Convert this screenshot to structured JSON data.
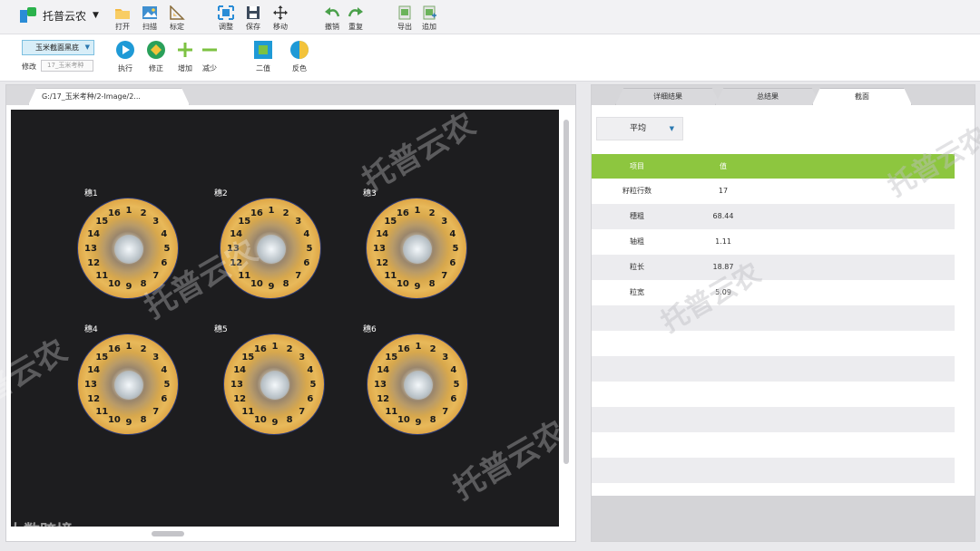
{
  "app": {
    "name": "托普云农"
  },
  "toolbar": {
    "open": "打开",
    "scan": "扫描",
    "calibrate": "标定",
    "adjust": "调整",
    "save": "保存",
    "move": "移动",
    "undo": "撤销",
    "redo": "重复",
    "export": "导出",
    "append": "追加"
  },
  "ribbon": {
    "mode_value": "玉米截面黑底",
    "edit_label": "修改",
    "edit_value": "17_玉米考种",
    "execute": "执行",
    "correct": "修正",
    "add": "增加",
    "reduce": "减少",
    "binary": "二值",
    "invert": "反色"
  },
  "image_panel": {
    "tab_label": "G:/17_玉米考种/2-Image/2...",
    "ears": [
      {
        "label": "穗1"
      },
      {
        "label": "穗2"
      },
      {
        "label": "穗3"
      },
      {
        "label": "穗4"
      },
      {
        "label": "穗5"
      },
      {
        "label": "穗6"
      }
    ],
    "kernel_numbers": [
      "1",
      "2",
      "3",
      "4",
      "5",
      "6",
      "7",
      "8",
      "9",
      "10",
      "11",
      "12",
      "13",
      "14",
      "15",
      "16"
    ]
  },
  "results_panel": {
    "tabs": [
      "详细结果",
      "总结果",
      "截面"
    ],
    "active_tab": "截面",
    "aggregate_value": "平均",
    "table": {
      "headers": [
        "项目",
        "值"
      ],
      "rows": [
        [
          "籽粒行数",
          "17"
        ],
        [
          "穗粗",
          "68.44"
        ],
        [
          "轴粗",
          "1.11"
        ],
        [
          "粒长",
          "18.87"
        ],
        [
          "粒宽",
          "5.09"
        ]
      ]
    }
  },
  "watermark": {
    "text": "托普云农",
    "brand": "大数跨境"
  },
  "colors": {
    "header_green": "#8dc63f",
    "canvas_bg": "#1d1d1f",
    "accent_blue": "#2a8cd6"
  }
}
